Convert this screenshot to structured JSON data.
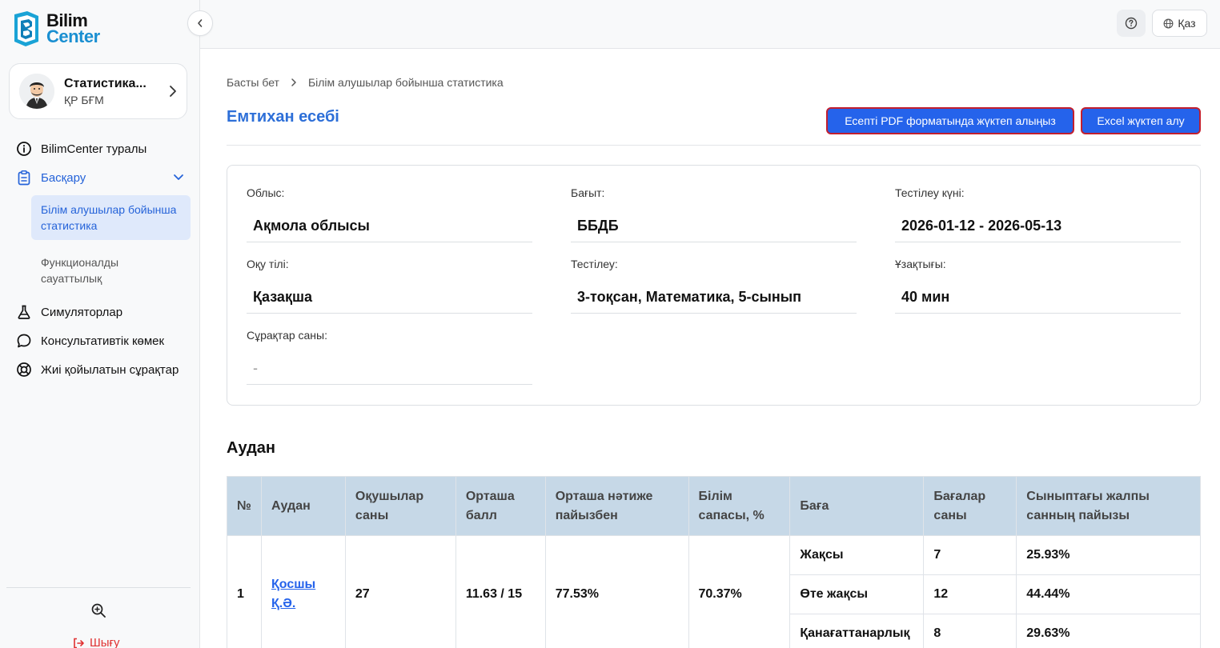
{
  "brand": {
    "line1": "Bilim",
    "line2": "Center"
  },
  "profile": {
    "name": "Статистика...",
    "org": "ҚР БҒМ"
  },
  "nav": {
    "about": "BilimCenter туралы",
    "manage": "Басқару",
    "sub_stats": "Білім алушылар бойынша статистика",
    "sub_literacy": "Функционалды сауаттылық",
    "simulators": "Симуляторлар",
    "consult": "Консультативтік көмек",
    "faq": "Жиі қойылатын сұрақтар"
  },
  "logout": "Шығу",
  "topbar": {
    "lang": "Қаз"
  },
  "breadcrumb": {
    "home": "Басты бет",
    "current": "Білім алушылар бойынша статистика"
  },
  "page": {
    "title": "Емтихан есебі",
    "btn_pdf": "Есепті PDF форматында жүктеп алыңыз",
    "btn_excel": "Excel жүктеп алу"
  },
  "info": {
    "region_label": "Облыс:",
    "region": "Ақмола облысы",
    "direction_label": "Бағыт:",
    "direction": "ББДБ",
    "date_label": "Тестілеу күні:",
    "date": "2026-01-12 - 2026-05-13",
    "lang_label": "Оқу тілі:",
    "lang": "Қазақша",
    "test_label": "Тестілеу:",
    "test": "3-тоқсан, Математика, 5-сынып",
    "duration_label": "Ұзақтығы:",
    "duration": "40 мин",
    "questions_label": "Сұрақтар саны:",
    "questions": "-"
  },
  "section": {
    "title": "Аудан"
  },
  "table": {
    "headers": [
      "№",
      "Аудан",
      "Оқушылар саны",
      "Орташа балл",
      "Орташа нәтиже пайызбен",
      "Білім сапасы, %",
      "Баға",
      "Бағалар саны",
      "Сыныптағы жалпы санның пайызы"
    ],
    "rows": [
      {
        "num": "1",
        "district": "Қосшы Қ.Ә.",
        "students": "27",
        "avg_score": "11.63 / 15",
        "avg_percent": "77.53%",
        "quality": "70.37%",
        "grades": [
          {
            "grade": "Жақсы",
            "count": "7",
            "percent": "25.93%"
          },
          {
            "grade": "Өте жақсы",
            "count": "12",
            "percent": "44.44%"
          },
          {
            "grade": "Қанағаттанарлық",
            "count": "8",
            "percent": "29.63%"
          }
        ]
      }
    ]
  },
  "colors": {
    "accent": "#2563eb",
    "title": "#2d6fd8",
    "header_bg": "#c6d8e7",
    "danger": "#e03131"
  }
}
